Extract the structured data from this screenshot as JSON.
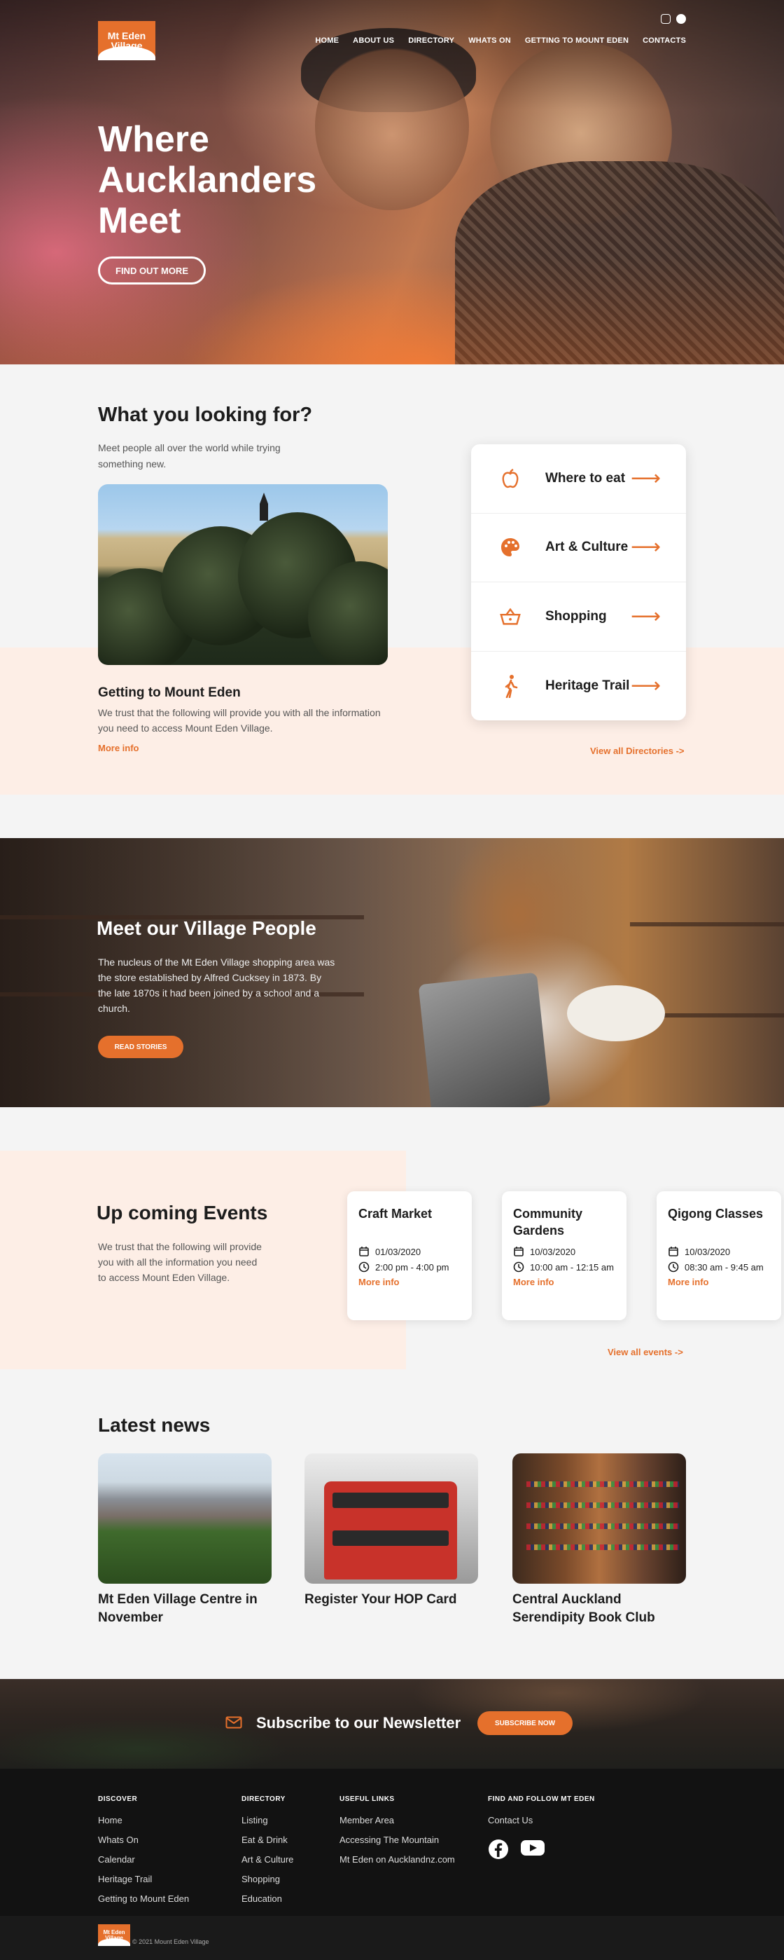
{
  "brand": {
    "logo_line1": "Mt Eden",
    "logo_line2": "Village",
    "accent": "#e5702c"
  },
  "header": {
    "social": [
      "instagram-icon",
      "facebook-icon"
    ],
    "nav": [
      "HOME",
      "ABOUT US",
      "DIRECTORY",
      "WHATS ON",
      "GETTING TO MOUNT EDEN",
      "CONTACTS"
    ]
  },
  "hero": {
    "headline": "Where Aucklanders Meet",
    "cta": "FIND OUT MORE"
  },
  "looking": {
    "title": "What you looking for?",
    "description": "Meet people all over the world while trying something new.",
    "getting_title": "Getting to Mount Eden",
    "getting_description": "We trust that the following will provide you with all the information you need to access Mount Eden Village.",
    "more_info": "More info",
    "directory": [
      {
        "label": "Where to eat",
        "icon": "apple-icon"
      },
      {
        "label": "Art & Culture",
        "icon": "palette-icon"
      },
      {
        "label": "Shopping",
        "icon": "basket-icon"
      },
      {
        "label": "Heritage Trail",
        "icon": "walking-icon"
      }
    ],
    "view_all": "View all Directories ->"
  },
  "village": {
    "title": "Meet our Village People",
    "description": "The nucleus of the Mt Eden Village shopping area was the store established by Alfred Cucksey in 1873. By the late 1870s it had been joined by a school and a church.",
    "cta": "READ STORIES"
  },
  "events": {
    "title": "Up coming Events",
    "description": "We trust that the following will provide you with all the information you need to access Mount Eden Village.",
    "items": [
      {
        "title": "Craft Market",
        "date": "01/03/2020",
        "time": "2:00 pm - 4:00 pm",
        "more": "More info"
      },
      {
        "title": "Community Gardens",
        "date": "10/03/2020",
        "time": "10:00 am - 12:15 am",
        "more": "More info"
      },
      {
        "title": "Qigong Classes",
        "date": "10/03/2020",
        "time": "08:30 am - 9:45 am",
        "more": "More info"
      }
    ],
    "view_all": "View all events ->"
  },
  "news": {
    "title": "Latest news",
    "items": [
      {
        "title": "Mt Eden Village Centre in November"
      },
      {
        "title": "Register Your HOP Card"
      },
      {
        "title": "Central Auckland Serendipity Book Club"
      }
    ]
  },
  "newsletter": {
    "text": "Subscribe to our Newsletter",
    "cta": "SUBSCRIBE NOW"
  },
  "footer": {
    "discover": {
      "heading": "DISCOVER",
      "links": [
        "Home",
        "Whats On",
        "Calendar",
        "Heritage Trail",
        "Getting to Mount Eden"
      ]
    },
    "directory": {
      "heading": "DIRECTORY",
      "links": [
        "Listing",
        "Eat & Drink",
        "Art & Culture",
        "Shopping",
        "Education"
      ]
    },
    "useful": {
      "heading": "USEFUL LINKS",
      "links": [
        "Member Area",
        "Accessing The Mountain",
        "Mt Eden on Aucklandnz.com"
      ]
    },
    "follow": {
      "heading": "FIND AND FOLLOW MT EDEN",
      "links": [
        "Contact Us"
      ],
      "social": [
        "facebook-icon",
        "youtube-icon"
      ]
    },
    "copyright": "© 2021 Mount Eden Village"
  }
}
